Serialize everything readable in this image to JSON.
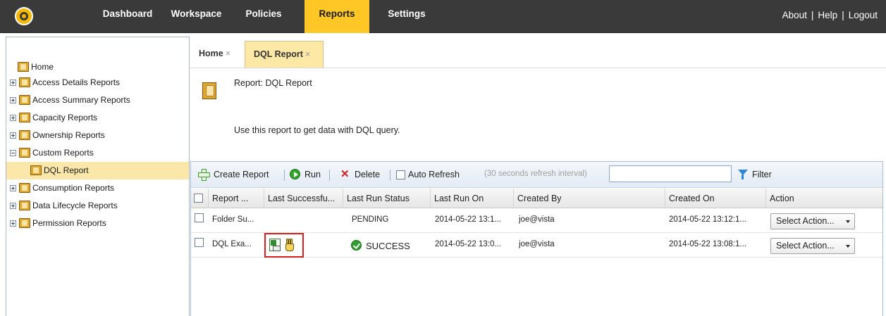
{
  "nav": {
    "items": [
      {
        "label": "Dashboard"
      },
      {
        "label": "Workspace"
      },
      {
        "label": "Policies"
      },
      {
        "label": "Reports"
      },
      {
        "label": "Settings"
      }
    ],
    "active": "Reports",
    "links": {
      "about": "About",
      "help": "Help",
      "logout": "Logout",
      "separator": "|"
    }
  },
  "sidebar": {
    "items": [
      {
        "label": "Home"
      },
      {
        "label": "Access Details Reports",
        "expander": "plus"
      },
      {
        "label": "Access Summary Reports",
        "expander": "plus"
      },
      {
        "label": "Capacity Reports",
        "expander": "plus"
      },
      {
        "label": "Ownership Reports",
        "expander": "plus"
      },
      {
        "label": "Custom Reports",
        "expander": "minus"
      },
      {
        "label": "DQL Report",
        "selected": true
      },
      {
        "label": "Consumption Reports",
        "expander": "plus"
      },
      {
        "label": "Data Lifecycle Reports",
        "expander": "plus"
      },
      {
        "label": "Permission Reports",
        "expander": "plus"
      }
    ]
  },
  "tabs": [
    {
      "label": "Home",
      "close": "×"
    },
    {
      "label": "DQL Report",
      "close": "×",
      "active": true
    }
  ],
  "report": {
    "title": "Report: DQL Report",
    "description": "Use this report to get data with DQL query."
  },
  "toolbar": {
    "create_label": "Create Report",
    "run_label": "Run",
    "delete_label": "Delete",
    "delete_glyph": "✕",
    "auto_refresh_label": "Auto Refresh",
    "refresh_note": "(30 seconds refresh interval)",
    "filter_value": "",
    "filter_label": "Filter",
    "separator": "|"
  },
  "table": {
    "columns": [
      "Report ...",
      "Last Successfu...",
      "Last Run Status",
      "Last Run On",
      "Created By",
      "Created On",
      "Action"
    ],
    "rows": [
      {
        "name": "Folder Su...",
        "last_successful": "",
        "status": "PENDING",
        "last_run_on": "2014-05-22 13:1...",
        "created_by": "joe@vista",
        "created_on": "2014-05-22 13:12:1...",
        "action": "Select Action..."
      },
      {
        "name": "DQL Exa...",
        "last_successful": "icons",
        "status": "SUCCESS",
        "last_run_on": "2014-05-22 13:0...",
        "created_by": "joe@vista",
        "created_on": "2014-05-22 13:08:1...",
        "action": "Select Action..."
      }
    ]
  },
  "colors": {
    "topbar": "#3a3a3a",
    "accent": "#ffc726",
    "selected_row": "#fce7ab",
    "highlight": "#d91e1e"
  }
}
